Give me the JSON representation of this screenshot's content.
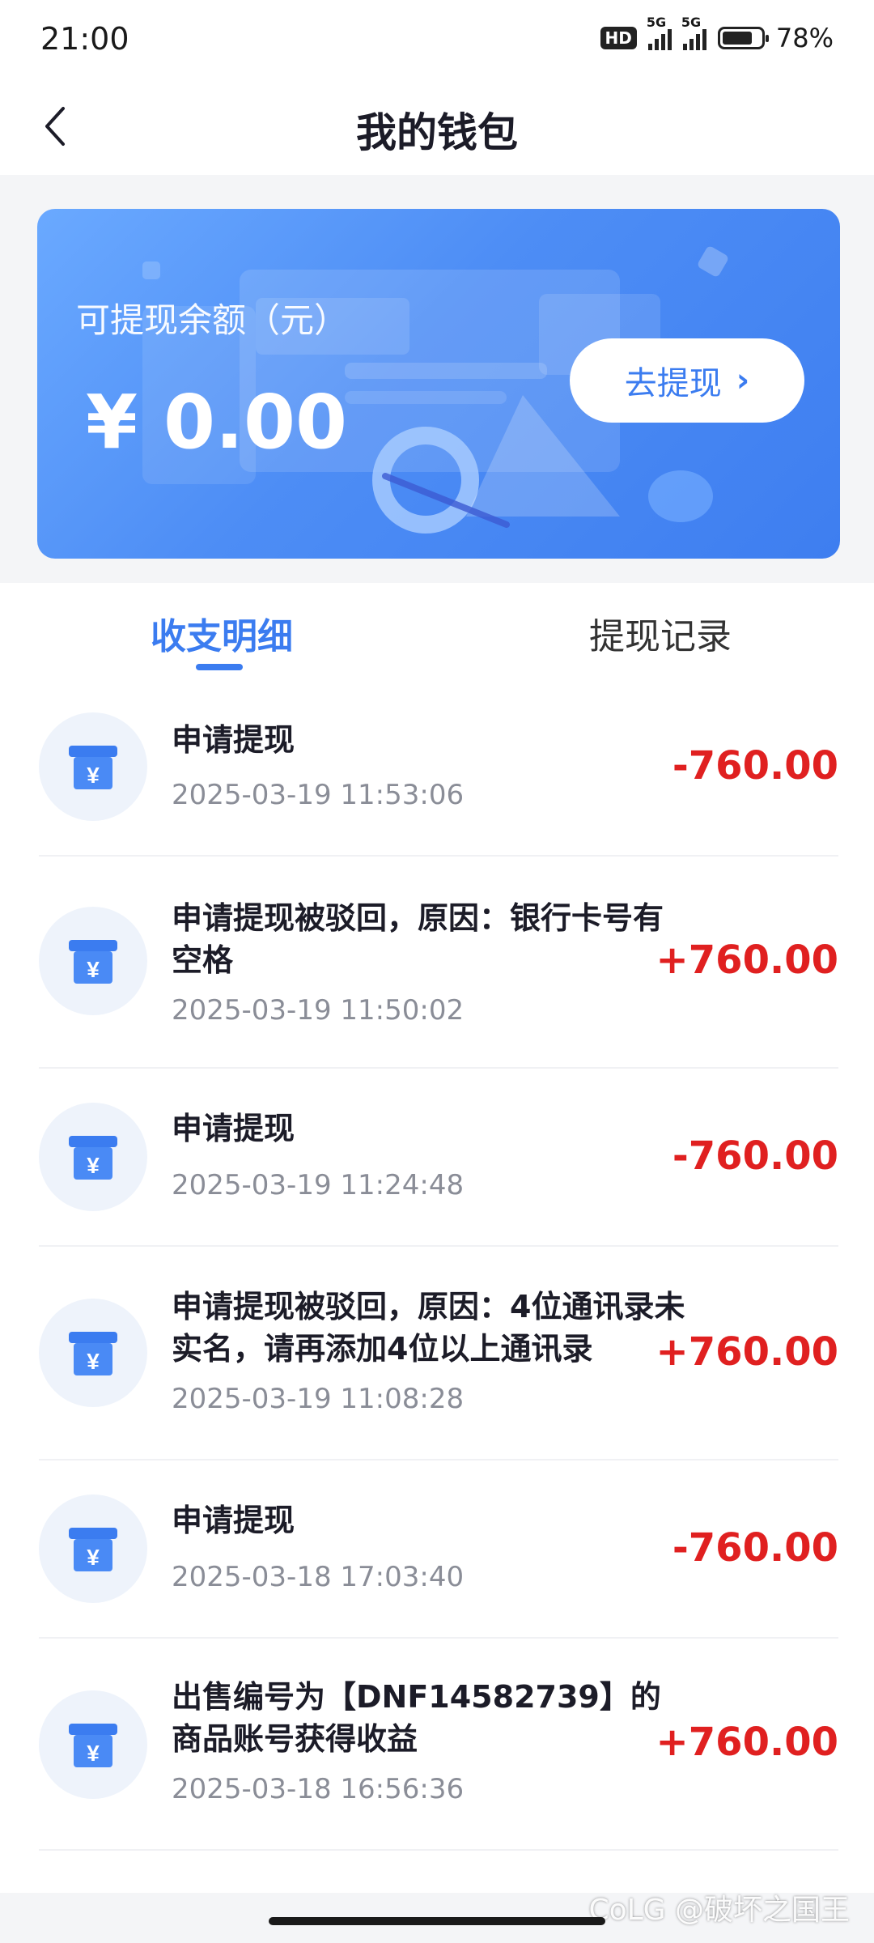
{
  "status": {
    "time": "21:00",
    "hd": "HD",
    "sim1": "5G",
    "sim2": "5G",
    "battery": "78%",
    "battery_level": 0.78
  },
  "header": {
    "title": "我的钱包"
  },
  "card": {
    "label": "可提现余额（元）",
    "amount": "¥ 0.00",
    "button_label": "去提现"
  },
  "tabs": [
    {
      "label": "收支明细",
      "active": true
    },
    {
      "label": "提现记录",
      "active": false
    }
  ],
  "transactions": [
    {
      "title": "申请提现",
      "time": "2025-03-19 11:53:06",
      "amount": "-760.00"
    },
    {
      "title": "申请提现被驳回，原因：银行卡号有空格",
      "time": "2025-03-19 11:50:02",
      "amount": "+760.00"
    },
    {
      "title": "申请提现",
      "time": "2025-03-19 11:24:48",
      "amount": "-760.00"
    },
    {
      "title": "申请提现被驳回，原因：4位通讯录未实名，请再添加4位以上通讯录",
      "time": "2025-03-19 11:08:28",
      "amount": "+760.00"
    },
    {
      "title": "申请提现",
      "time": "2025-03-18 17:03:40",
      "amount": "-760.00"
    },
    {
      "title": "出售编号为【DNF14582739】的商品账号获得收益",
      "time": "2025-03-18 16:56:36",
      "amount": "+760.00"
    }
  ],
  "watermark": "CoLG @破坏之国王"
}
